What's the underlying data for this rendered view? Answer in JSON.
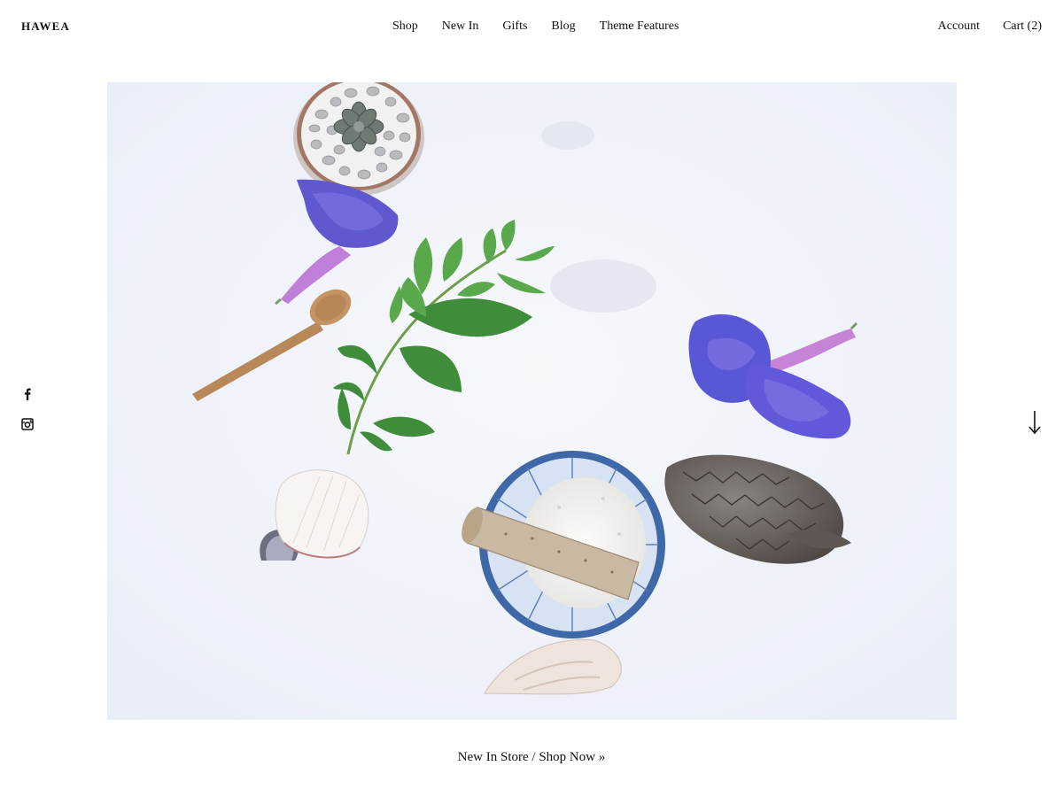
{
  "header": {
    "logo": "HAWEA",
    "nav": [
      {
        "label": "Shop"
      },
      {
        "label": "New In"
      },
      {
        "label": "Gifts"
      },
      {
        "label": "Blog"
      },
      {
        "label": "Theme Features"
      }
    ],
    "account_label": "Account",
    "cart_label": "Cart (2)"
  },
  "social": {
    "icons": [
      "facebook-icon",
      "instagram-icon"
    ]
  },
  "hero": {
    "image_description": "flat-lay-photo",
    "background_color": "#eef1f8"
  },
  "scroll": {
    "icon": "arrow-down-icon"
  },
  "caption": {
    "label": "New In Store / Shop Now »"
  }
}
